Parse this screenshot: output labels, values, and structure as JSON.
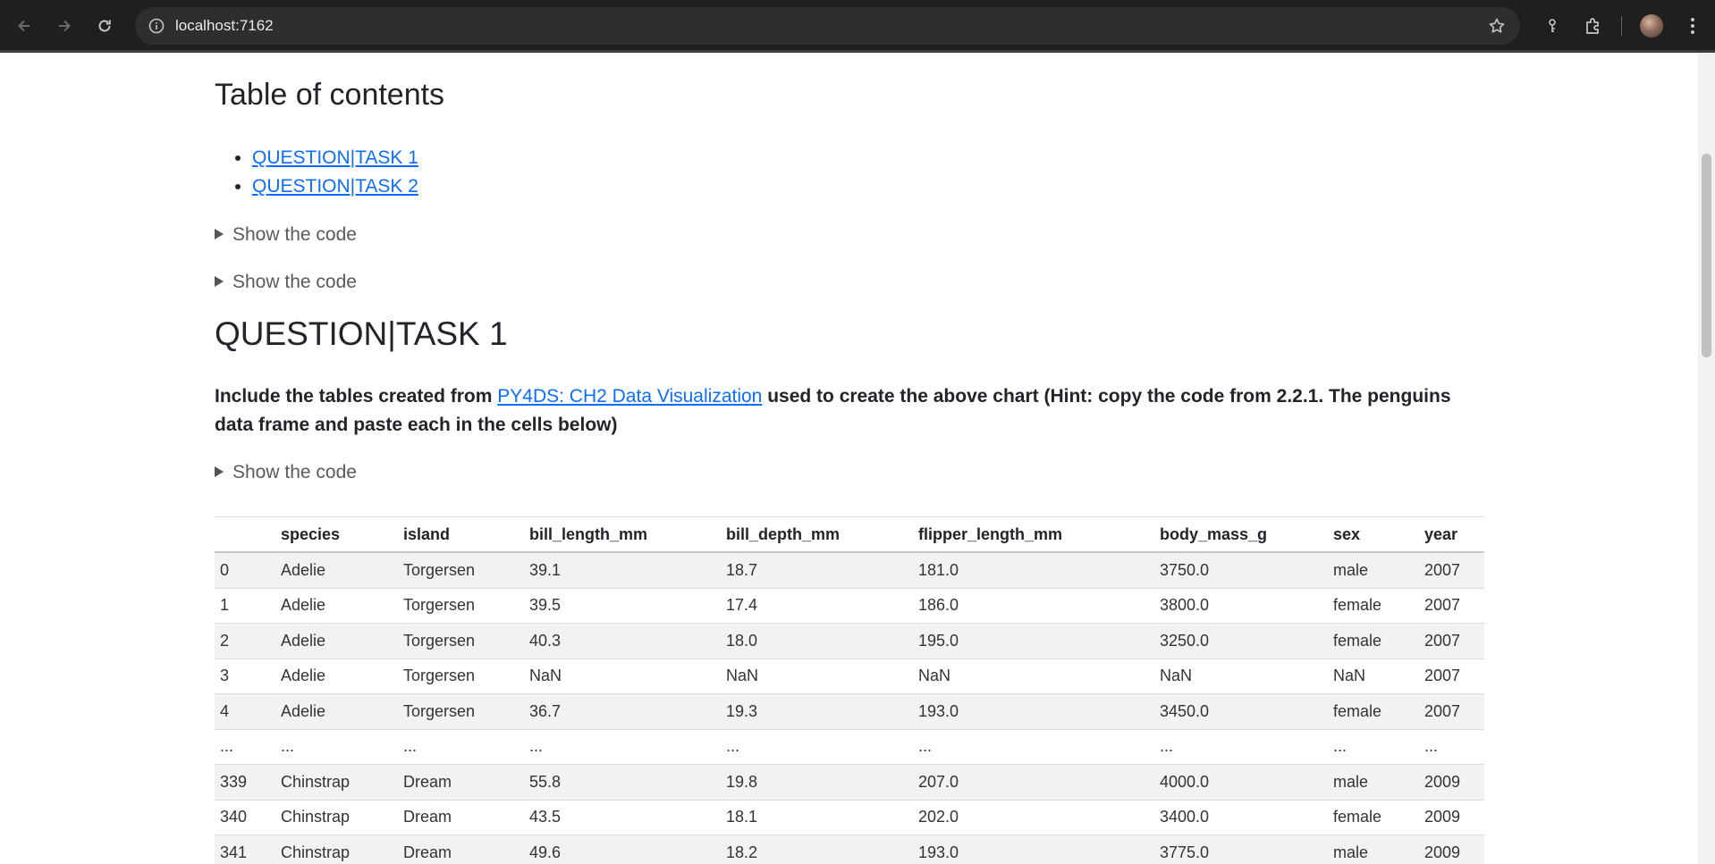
{
  "browser": {
    "url": "localhost:7162",
    "icons": [
      "back-arrow-icon",
      "forward-arrow-icon",
      "reload-icon",
      "site-info-icon",
      "bookmark-star-icon",
      "password-key-icon",
      "extensions-puzzle-icon",
      "profile-avatar",
      "more-menu-icon"
    ]
  },
  "toc": {
    "heading": "Table of contents",
    "items": [
      {
        "label": "QUESTION|TASK 1"
      },
      {
        "label": "QUESTION|TASK 2"
      }
    ]
  },
  "code_toggles": [
    "Show the code",
    "Show the code",
    "Show the code"
  ],
  "section": {
    "heading": "QUESTION|TASK 1",
    "paragraph_before": "Include the tables created from ",
    "link_text": "PY4DS: CH2 Data Visualization",
    "paragraph_after": " used to create the above chart (Hint: copy the code from 2.2.1. The penguins data frame and paste each in the cells below)"
  },
  "table": {
    "columns": [
      "",
      "species",
      "island",
      "bill_length_mm",
      "bill_depth_mm",
      "flipper_length_mm",
      "body_mass_g",
      "sex",
      "year"
    ],
    "rows": [
      [
        "0",
        "Adelie",
        "Torgersen",
        "39.1",
        "18.7",
        "181.0",
        "3750.0",
        "male",
        "2007"
      ],
      [
        "1",
        "Adelie",
        "Torgersen",
        "39.5",
        "17.4",
        "186.0",
        "3800.0",
        "female",
        "2007"
      ],
      [
        "2",
        "Adelie",
        "Torgersen",
        "40.3",
        "18.0",
        "195.0",
        "3250.0",
        "female",
        "2007"
      ],
      [
        "3",
        "Adelie",
        "Torgersen",
        "NaN",
        "NaN",
        "NaN",
        "NaN",
        "NaN",
        "2007"
      ],
      [
        "4",
        "Adelie",
        "Torgersen",
        "36.7",
        "19.3",
        "193.0",
        "3450.0",
        "female",
        "2007"
      ],
      [
        "...",
        "...",
        "...",
        "...",
        "...",
        "...",
        "...",
        "...",
        "..."
      ],
      [
        "339",
        "Chinstrap",
        "Dream",
        "55.8",
        "19.8",
        "207.0",
        "4000.0",
        "male",
        "2009"
      ],
      [
        "340",
        "Chinstrap",
        "Dream",
        "43.5",
        "18.1",
        "202.0",
        "3400.0",
        "female",
        "2009"
      ],
      [
        "341",
        "Chinstrap",
        "Dream",
        "49.6",
        "18.2",
        "193.0",
        "3775.0",
        "male",
        "2009"
      ]
    ]
  }
}
